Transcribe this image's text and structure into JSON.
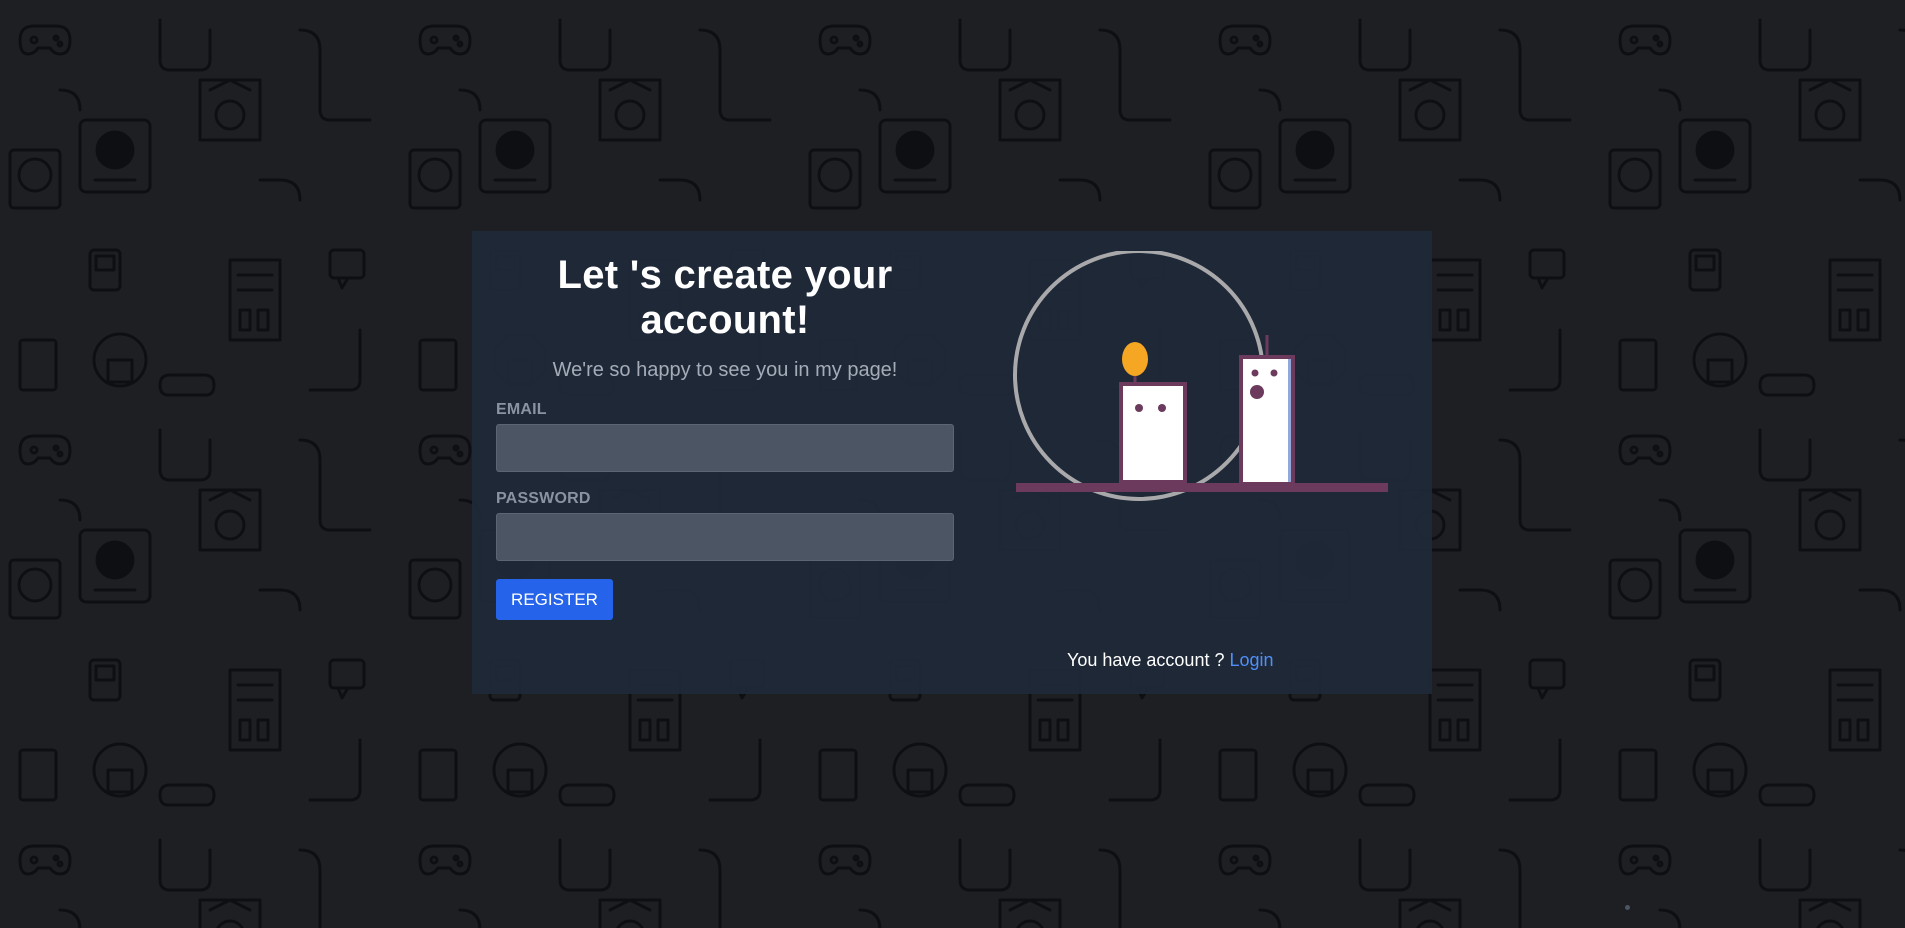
{
  "register_form": {
    "title": "Let 's create your account!",
    "subtitle": "We're so happy to see you in my page!",
    "email_label": "EMAIL",
    "email_value": "",
    "password_label": "PASSWORD",
    "password_value": "",
    "register_label": "REGISTER"
  },
  "login_prompt": {
    "text": "You have account ?",
    "link_label": "Login"
  },
  "colors": {
    "page_background": "#1e1f23",
    "card_background": "#1e2939",
    "input_background": "#4b5563",
    "button_primary": "#2563eb",
    "link": "#4f8ff7",
    "illustration_accent": "#6b3a5c",
    "flame": "#f5a623"
  },
  "icons": {
    "background_pattern": "game-console-pattern",
    "illustration": "two-candles-illustration"
  }
}
